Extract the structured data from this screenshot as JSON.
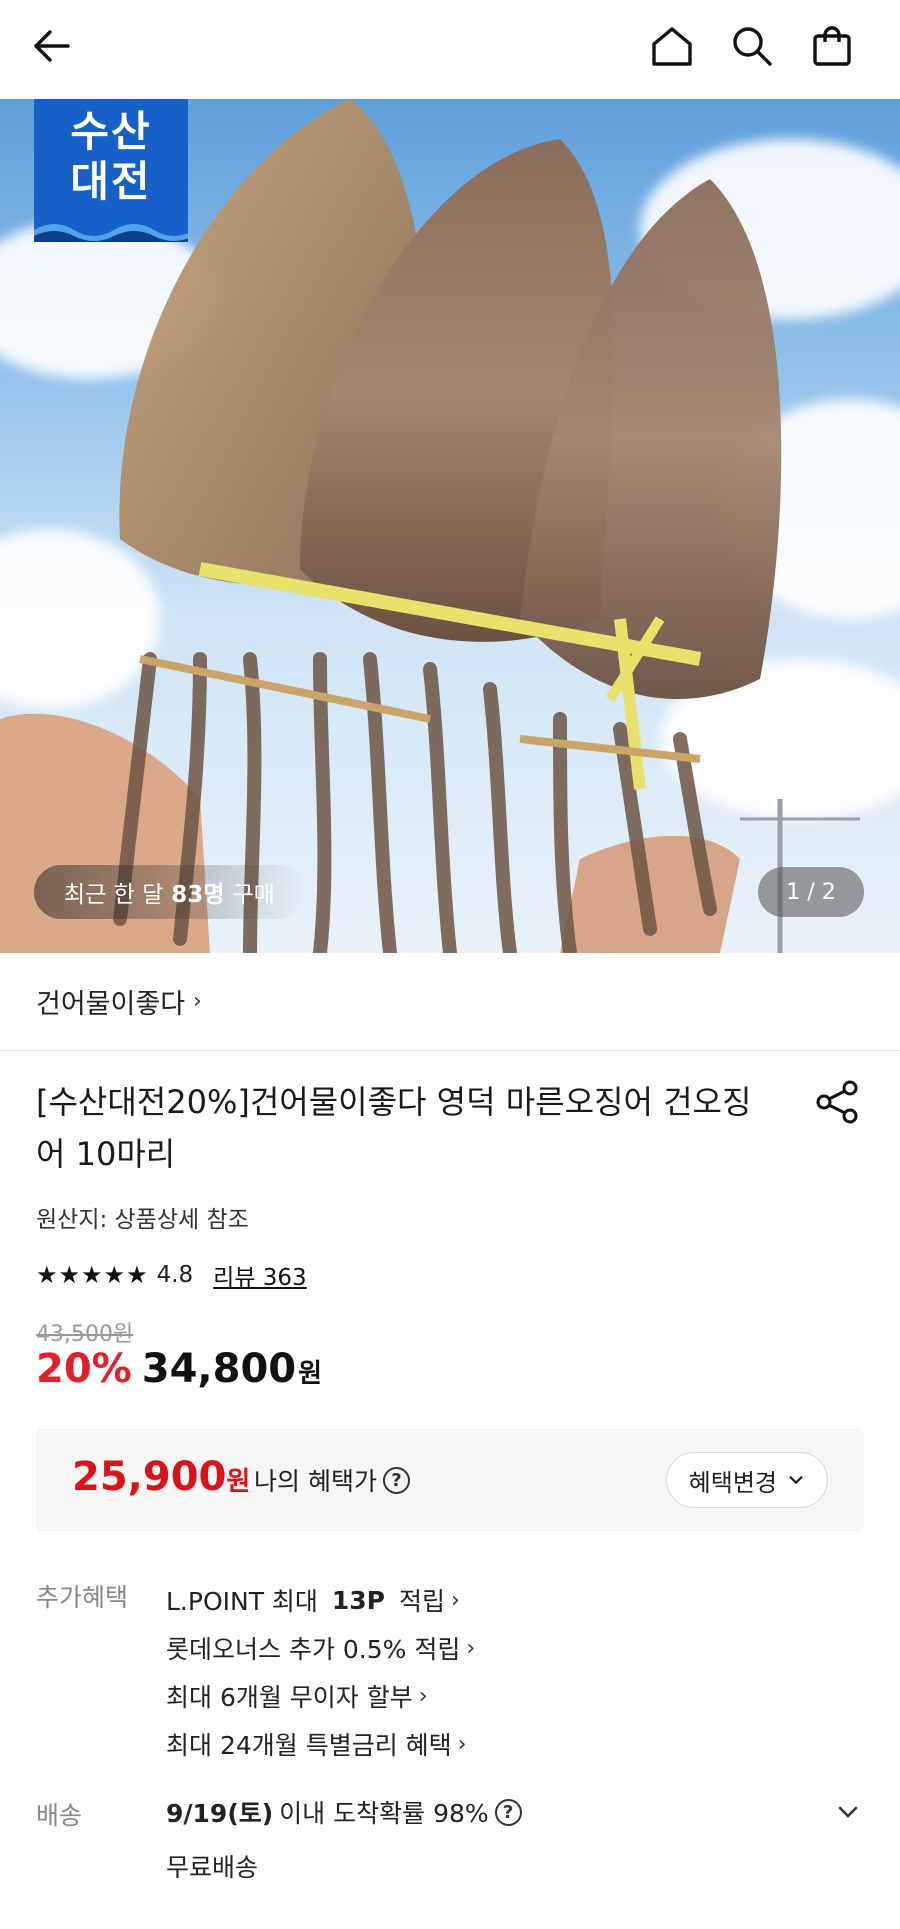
{
  "topbar": {
    "back_icon": "arrow-left-icon",
    "home_icon": "home-icon",
    "search_icon": "search-icon",
    "cart_icon": "shopping-bag-icon"
  },
  "hero": {
    "badge_line1": "수산",
    "badge_line2": "대전",
    "buyers_prefix": "최근 한 달",
    "buyers_count": "83명",
    "buyers_suffix": "구매",
    "pager": "1 / 2"
  },
  "store": {
    "name": "건어물이좋다",
    "chevron": "›"
  },
  "product": {
    "title": "[수산대전20%]건어물이좋다 영덕 마른오징어 건오징어 10마리",
    "origin": "원산지: 상품상세 참조",
    "stars": "★★★★★",
    "rating": "4.8",
    "reviews": "리뷰 363",
    "original_price": "43,500원",
    "discount": "20%",
    "price": "34,800",
    "price_unit": "원"
  },
  "benefit": {
    "price": "25,900",
    "unit": "원",
    "label": "나의 혜택가",
    "help": "?",
    "change_button": "혜택변경",
    "change_chevron": "⌄"
  },
  "extra": {
    "label": "추가혜택",
    "items": [
      {
        "pre": "L.POINT 최대 ",
        "bold": "13P",
        "post": " 적립",
        "chev": "›"
      },
      {
        "pre": "롯데오너스 추가 0.5% 적립",
        "bold": "",
        "post": "",
        "chev": "›"
      },
      {
        "pre": "최대 6개월 무이자 할부",
        "bold": "",
        "post": "",
        "chev": "›"
      },
      {
        "pre": "최대 24개월 특별금리 혜택",
        "bold": "",
        "post": "",
        "chev": "›"
      }
    ]
  },
  "shipping": {
    "label": "배송",
    "date": "9/19(토)",
    "text": "이내 도착확률 98%",
    "help": "?",
    "free": "무료배송"
  },
  "colors": {
    "accent_red": "#e12127",
    "badge_blue": "#1660c8"
  }
}
